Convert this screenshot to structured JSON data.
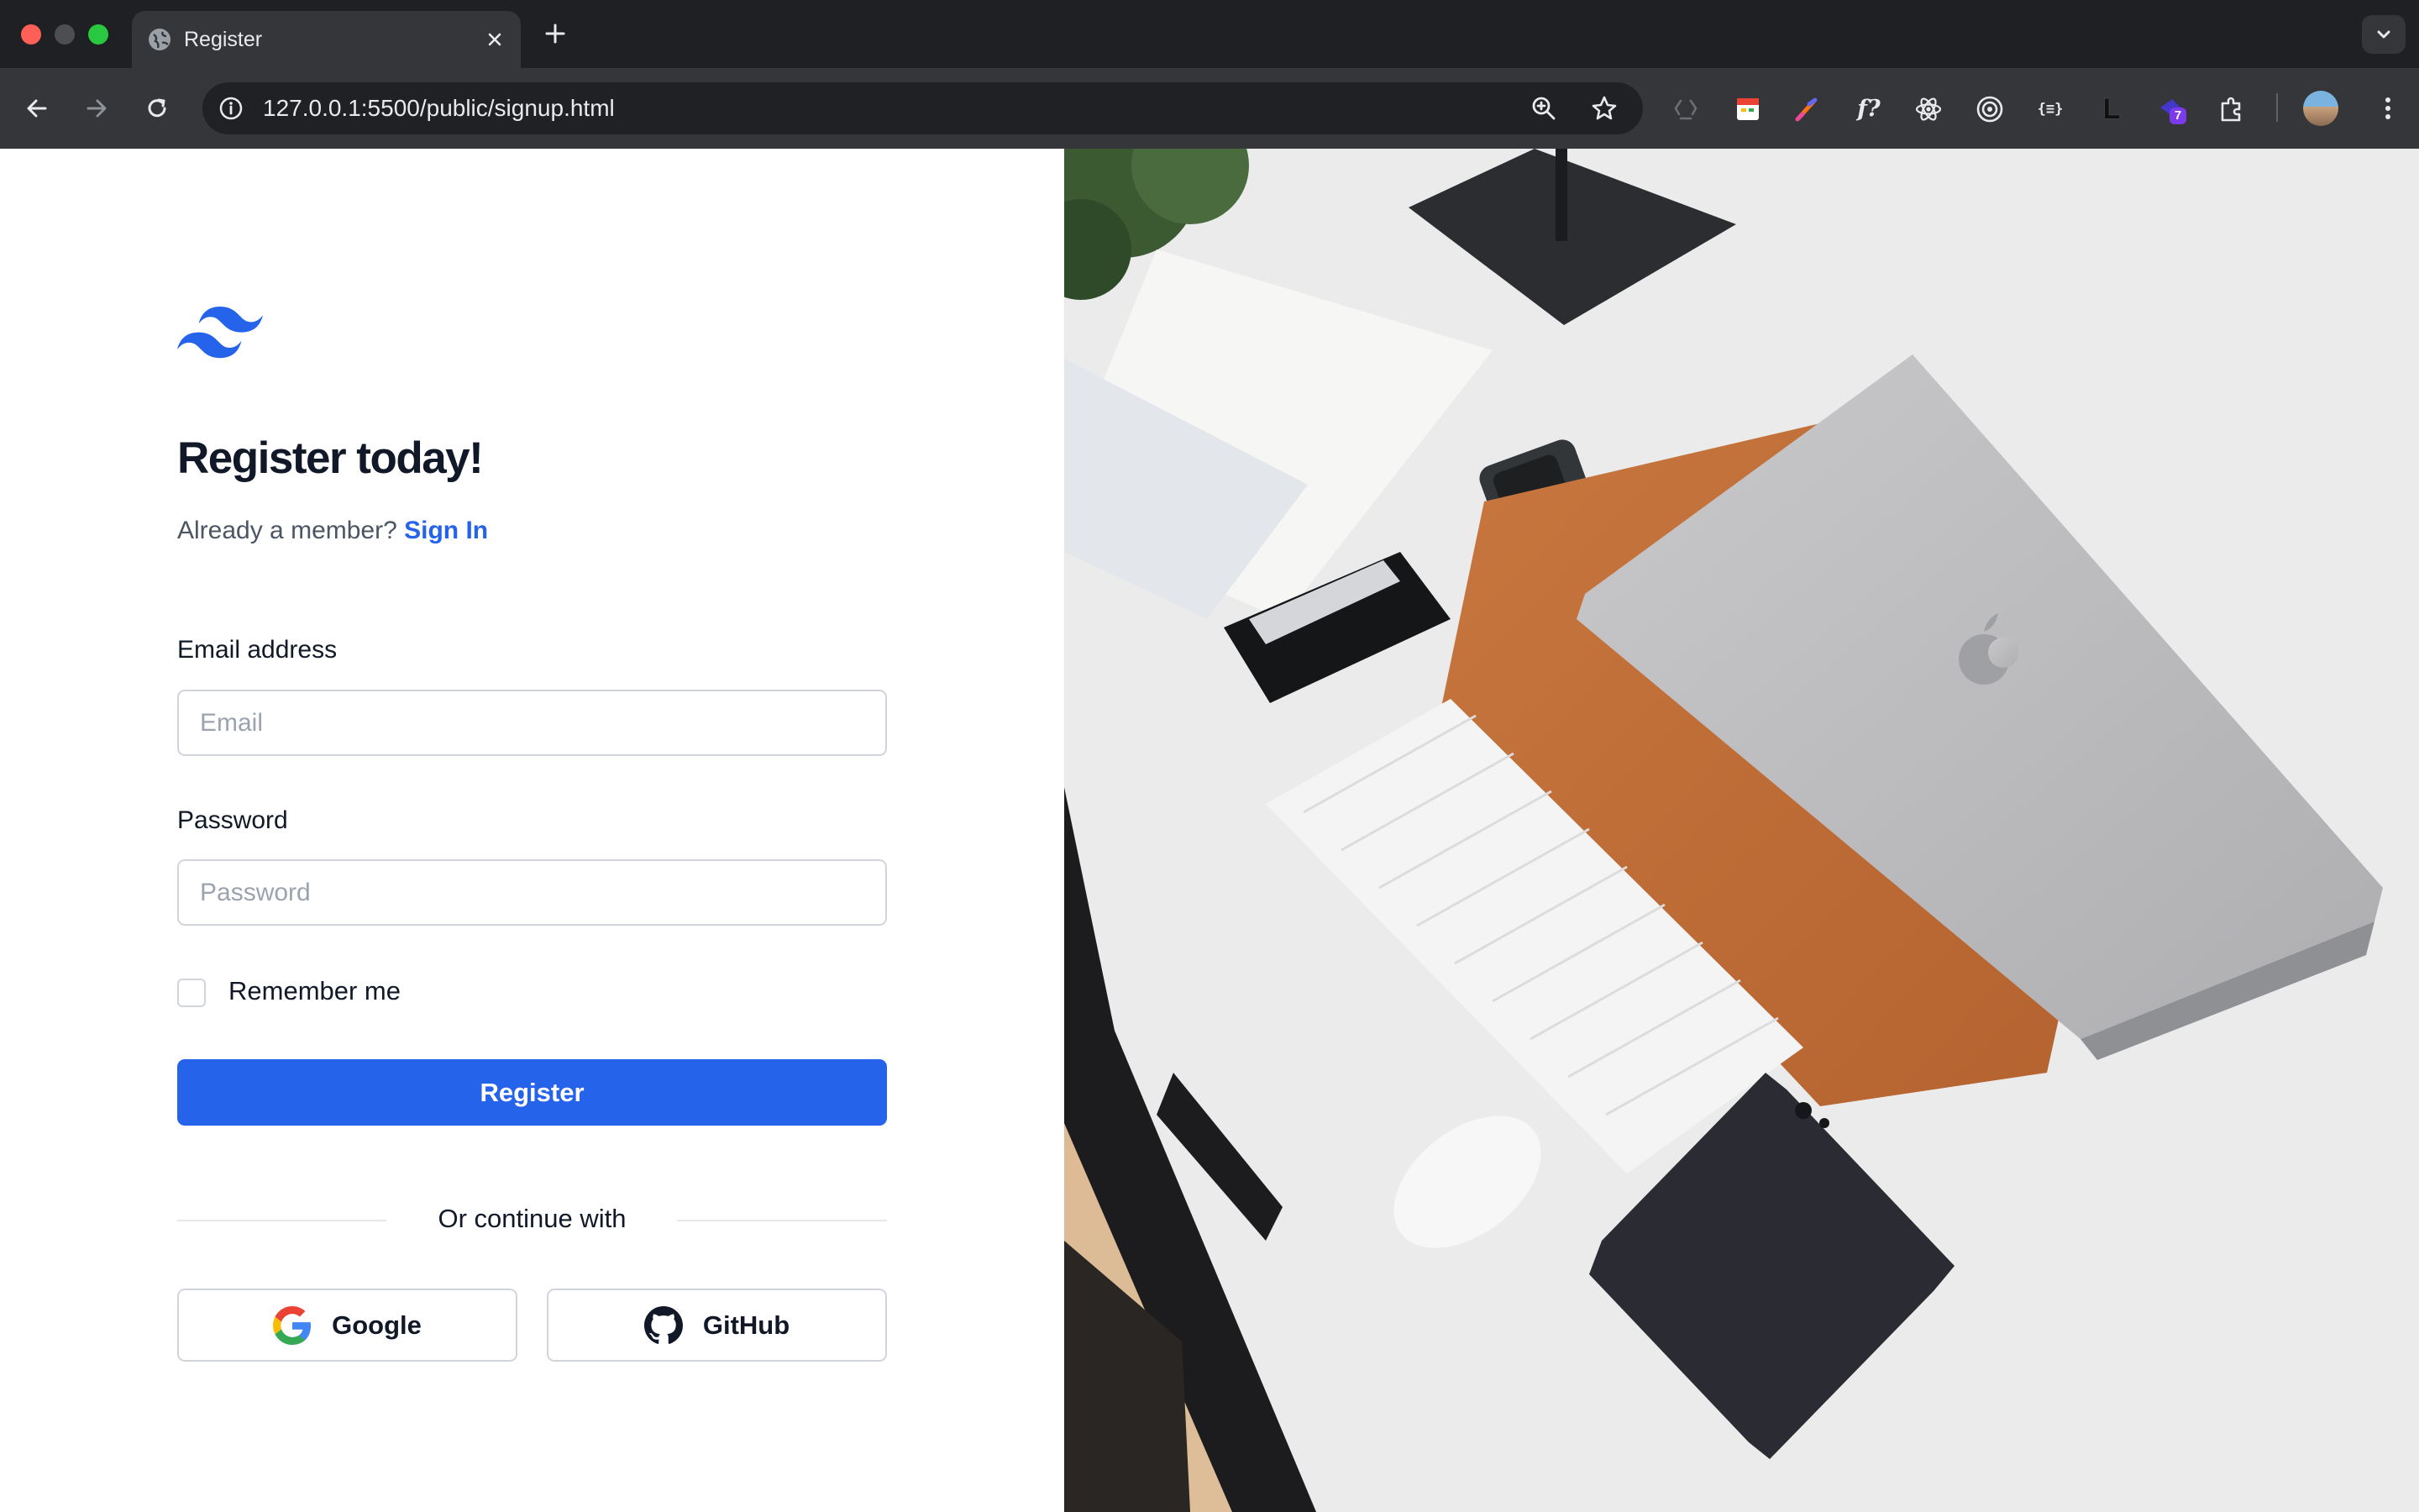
{
  "browser": {
    "tab_title": "Register",
    "url": "127.0.0.1:5500/public/signup.html",
    "extension_badge": "7",
    "extension_letter": "L",
    "extension_f": "f?",
    "extension_braces": "{≡}"
  },
  "page": {
    "heading": "Register today!",
    "subtext": "Already a member?",
    "signin_link": "Sign In",
    "email": {
      "label": "Email address",
      "placeholder": "Email"
    },
    "password": {
      "label": "Password",
      "placeholder": "Password"
    },
    "remember_label": "Remember me",
    "register_button": "Register",
    "divider_text": "Or continue with",
    "google_button": "Google",
    "github_button": "GitHub"
  },
  "colors": {
    "primary": "#2563eb",
    "heading": "#111827",
    "muted": "#4b5563",
    "border": "#d1d5db",
    "chrome_dark": "#1f2023",
    "chrome_toolbar": "#35363a"
  },
  "icons": {
    "logo": "tailwind-logo-icon",
    "google": "google-icon",
    "github": "github-icon"
  }
}
